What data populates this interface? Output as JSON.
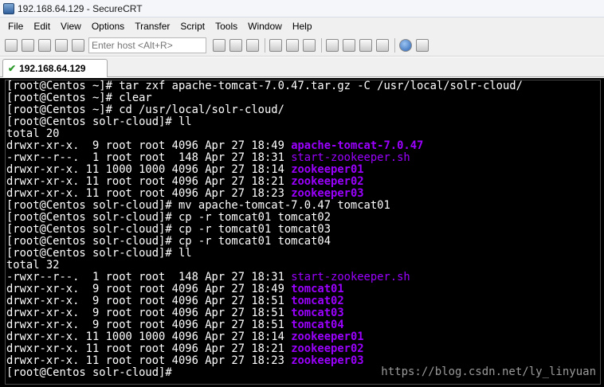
{
  "window": {
    "title": "192.168.64.129 - SecureCRT"
  },
  "menubar": {
    "items": [
      "File",
      "Edit",
      "View",
      "Options",
      "Transfer",
      "Script",
      "Tools",
      "Window",
      "Help"
    ]
  },
  "toolbar": {
    "quick_connect_placeholder": "Enter host <Alt+R>"
  },
  "tabs": [
    {
      "label": "192.168.64.129",
      "status": "connected"
    }
  ],
  "terminal": {
    "lines": [
      {
        "text": "[root@Centos ~]# tar zxf apache-tomcat-7.0.47.tar.gz -C /usr/local/solr-cloud/"
      },
      {
        "text": "[root@Centos ~]# clear"
      },
      {
        "text": "[root@Centos ~]# cd /usr/local/solr-cloud/"
      },
      {
        "text": "[root@Centos solr-cloud]# ll"
      },
      {
        "text": "total 20"
      },
      {
        "text": "drwxr-xr-x.  9 root root 4096 Apr 27 18:49 ",
        "name": "apache-tomcat-7.0.47",
        "kind": "dir"
      },
      {
        "text": "-rwxr--r--.  1 root root  148 Apr 27 18:31 ",
        "name": "start-zookeeper.sh",
        "kind": "exe"
      },
      {
        "text": "drwxr-xr-x. 11 1000 1000 4096 Apr 27 18:14 ",
        "name": "zookeeper01",
        "kind": "dir"
      },
      {
        "text": "drwxr-xr-x. 11 root root 4096 Apr 27 18:21 ",
        "name": "zookeeper02",
        "kind": "dir"
      },
      {
        "text": "drwxr-xr-x. 11 root root 4096 Apr 27 18:23 ",
        "name": "zookeeper03",
        "kind": "dir"
      },
      {
        "text": "[root@Centos solr-cloud]# mv apache-tomcat-7.0.47 tomcat01"
      },
      {
        "text": "[root@Centos solr-cloud]# cp -r tomcat01 tomcat02"
      },
      {
        "text": "[root@Centos solr-cloud]# cp -r tomcat01 tomcat03"
      },
      {
        "text": "[root@Centos solr-cloud]# cp -r tomcat01 tomcat04"
      },
      {
        "text": "[root@Centos solr-cloud]# ll"
      },
      {
        "text": "total 32"
      },
      {
        "text": "-rwxr--r--.  1 root root  148 Apr 27 18:31 ",
        "name": "start-zookeeper.sh",
        "kind": "exe"
      },
      {
        "text": "drwxr-xr-x.  9 root root 4096 Apr 27 18:49 ",
        "name": "tomcat01",
        "kind": "dir"
      },
      {
        "text": "drwxr-xr-x.  9 root root 4096 Apr 27 18:51 ",
        "name": "tomcat02",
        "kind": "dir"
      },
      {
        "text": "drwxr-xr-x.  9 root root 4096 Apr 27 18:51 ",
        "name": "tomcat03",
        "kind": "dir"
      },
      {
        "text": "drwxr-xr-x.  9 root root 4096 Apr 27 18:51 ",
        "name": "tomcat04",
        "kind": "dir"
      },
      {
        "text": "drwxr-xr-x. 11 1000 1000 4096 Apr 27 18:14 ",
        "name": "zookeeper01",
        "kind": "dir"
      },
      {
        "text": "drwxr-xr-x. 11 root root 4096 Apr 27 18:21 ",
        "name": "zookeeper02",
        "kind": "dir"
      },
      {
        "text": "drwxr-xr-x. 11 root root 4096 Apr 27 18:23 ",
        "name": "zookeeper03",
        "kind": "dir"
      },
      {
        "text": "[root@Centos solr-cloud]# ",
        "cursor": true
      }
    ]
  },
  "watermark": {
    "text": "https://blog.csdn.net/ly_linyuan"
  },
  "colors": {
    "terminal_bg": "#000000",
    "terminal_fg": "#ffffff",
    "listing_highlight": "#9b00ff"
  }
}
